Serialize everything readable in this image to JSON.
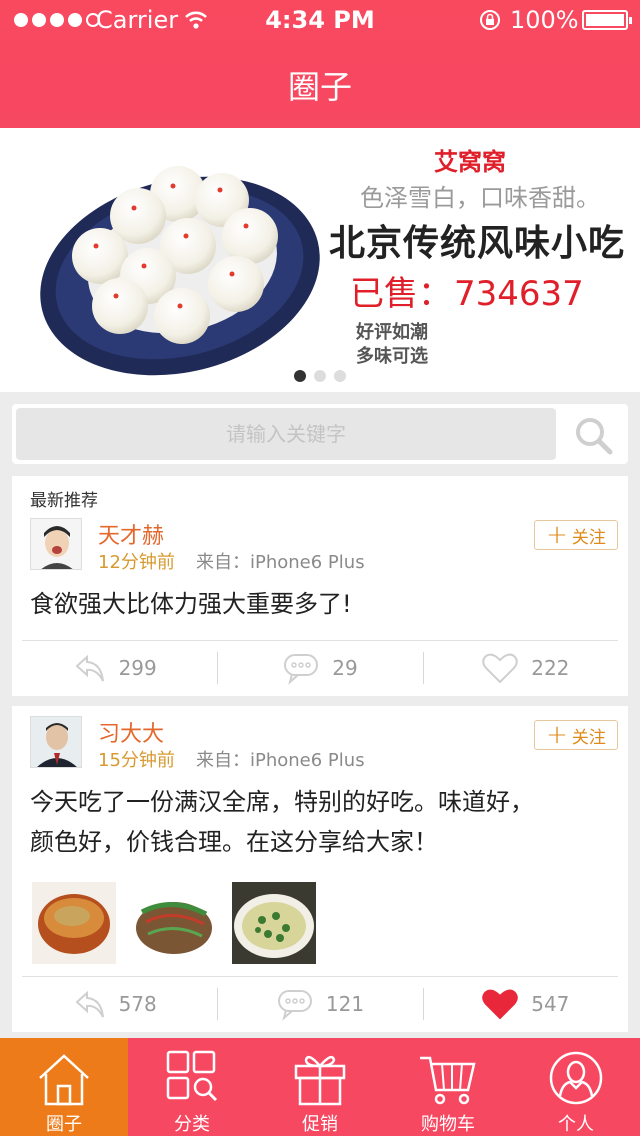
{
  "status_bar": {
    "carrier": "Carrier",
    "time": "4:34 PM",
    "battery": "100%"
  },
  "nav": {
    "title": "圈子"
  },
  "banner": {
    "brand": "艾窝窝",
    "slogan": "色泽雪白，口味香甜。",
    "headline": "北京传统风味小吃",
    "sold_label": "已售：",
    "sold_count": "734637",
    "line1": "好评如潮",
    "line2": "多味可选",
    "slide_count": 3,
    "active_slide": 1
  },
  "search": {
    "placeholder": "请输入关键字",
    "icon": "search-icon"
  },
  "feed": {
    "section_title": "最新推荐",
    "posts": [
      {
        "user": "天才赫",
        "time": "12分钟前",
        "source": "来自：iPhone6 Plus",
        "follow_label": "关注",
        "text": "食欲强大比体力强大重要多了!",
        "reposts": "299",
        "comments": "29",
        "likes": "222",
        "liked": false
      },
      {
        "user": "习大大",
        "time": "15分钟前",
        "source": "来自：iPhone6 Plus",
        "follow_label": "关注",
        "text_line1": "今天吃了一份满汉全席，特别的好吃。味道好，",
        "text_line2": "颜色好，价钱合理。在这分享给大家！",
        "reposts": "578",
        "comments": "121",
        "likes": "547",
        "liked": true
      }
    ]
  },
  "tabbar": {
    "items": [
      {
        "label": "圈子",
        "icon": "home-icon",
        "active": true
      },
      {
        "label": "分类",
        "icon": "category-icon",
        "active": false
      },
      {
        "label": "促销",
        "icon": "gift-icon",
        "active": false
      },
      {
        "label": "购物车",
        "icon": "cart-icon",
        "active": false
      },
      {
        "label": "个人",
        "icon": "user-icon",
        "active": false
      }
    ]
  },
  "colors": {
    "brand": "#f74862",
    "active_tab": "#ee7b1a",
    "username": "#e4682c",
    "like": "#e8283a"
  }
}
